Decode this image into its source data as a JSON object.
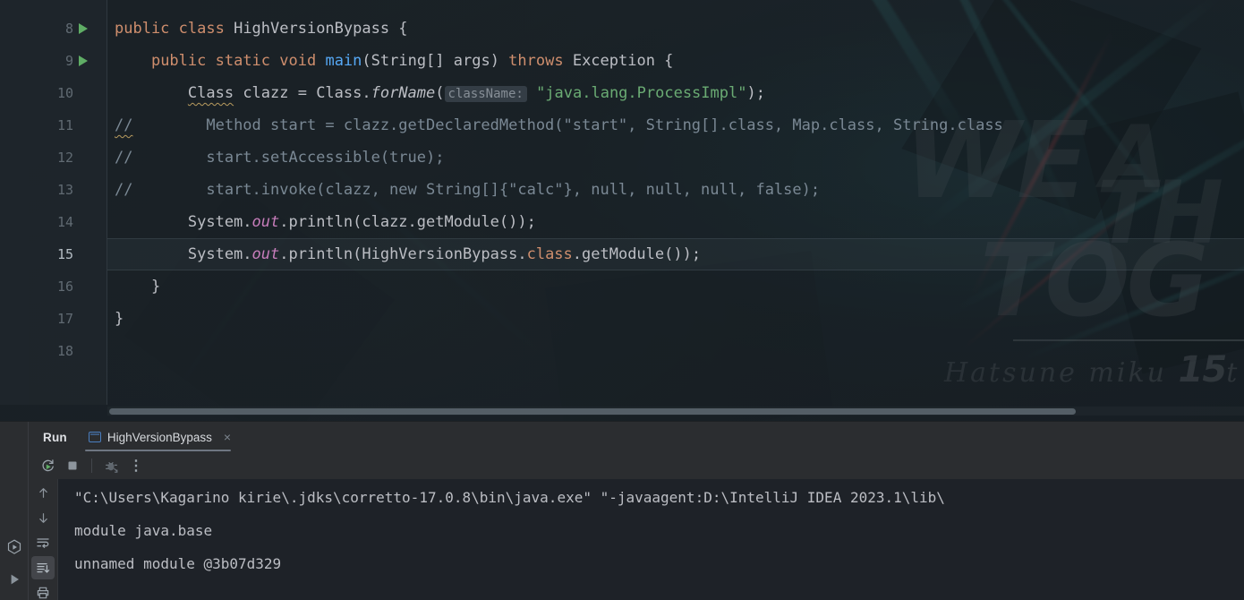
{
  "editor": {
    "first_line_number": 8,
    "current_line_number": 15,
    "lines": [
      {
        "number": "8",
        "has_run_marker": true,
        "tokens": [
          {
            "text": "public ",
            "style": "kw"
          },
          {
            "text": "class ",
            "style": "kw"
          },
          {
            "text": "HighVersionBypass {",
            "style": "plain"
          }
        ]
      },
      {
        "number": "9",
        "has_run_marker": true,
        "tokens": [
          {
            "text": "    ",
            "style": "plain"
          },
          {
            "text": "public ",
            "style": "kw"
          },
          {
            "text": "static ",
            "style": "kw"
          },
          {
            "text": "void ",
            "style": "kw"
          },
          {
            "text": "main",
            "style": "meth"
          },
          {
            "text": "(String[] args) ",
            "style": "plain"
          },
          {
            "text": "throws ",
            "style": "kw"
          },
          {
            "text": "Exception {",
            "style": "plain"
          }
        ]
      },
      {
        "number": "10",
        "has_run_marker": false,
        "tokens": [
          {
            "text": "        ",
            "style": "plain"
          },
          {
            "text": "Class",
            "style": "wavy"
          },
          {
            "text": " clazz = Class.",
            "style": "plain"
          },
          {
            "text": "forName",
            "style": "statmeth"
          },
          {
            "text": "(",
            "style": "plain"
          },
          {
            "text": "className:",
            "style": "hintbox"
          },
          {
            "text": " ",
            "style": "plain"
          },
          {
            "text": "\"java.lang.ProcessImpl\"",
            "style": "str"
          },
          {
            "text": ");",
            "style": "plain"
          }
        ]
      },
      {
        "number": "11",
        "has_run_marker": false,
        "tokens": [
          {
            "text": "//",
            "style": "cmt-wavy"
          },
          {
            "text": "        Method start = clazz.getDeclaredMethod(\"start\", String[].class, Map.class, String.class",
            "style": "cmt"
          }
        ]
      },
      {
        "number": "12",
        "has_run_marker": false,
        "tokens": [
          {
            "text": "//",
            "style": "cmt"
          },
          {
            "text": "        start.setAccessible(true);",
            "style": "cmt"
          }
        ]
      },
      {
        "number": "13",
        "has_run_marker": false,
        "tokens": [
          {
            "text": "//",
            "style": "cmt"
          },
          {
            "text": "        start.invoke(clazz, new String[]{\"calc\"}, null, null, null, false);",
            "style": "cmt"
          }
        ]
      },
      {
        "number": "14",
        "has_run_marker": false,
        "tokens": [
          {
            "text": "        System.",
            "style": "plain"
          },
          {
            "text": "out",
            "style": "field"
          },
          {
            "text": ".println(clazz.getModule());",
            "style": "plain"
          }
        ]
      },
      {
        "number": "15",
        "has_run_marker": false,
        "is_current": true,
        "tokens": [
          {
            "text": "        System.",
            "style": "plain"
          },
          {
            "text": "out",
            "style": "field"
          },
          {
            "text": ".println(HighVersionBypass.",
            "style": "plain"
          },
          {
            "text": "class",
            "style": "kw"
          },
          {
            "text": ".getModule());",
            "style": "plain"
          }
        ]
      },
      {
        "number": "16",
        "has_run_marker": false,
        "tokens": [
          {
            "text": "    }",
            "style": "plain"
          }
        ]
      },
      {
        "number": "17",
        "has_run_marker": false,
        "tokens": [
          {
            "text": "}",
            "style": "plain"
          }
        ]
      },
      {
        "number": "18",
        "has_run_marker": false,
        "tokens": [
          {
            "text": "",
            "style": "plain"
          }
        ]
      }
    ]
  },
  "wallpaper": {
    "word_1": "WE",
    "word_2": "A",
    "word_3": "TH",
    "word_4": "TOG",
    "signature_text": "Hatsune miku ",
    "signature_big": "15",
    "signature_suffix": "t"
  },
  "run_window": {
    "title": "Run",
    "tab": {
      "label": "HighVersionBypass",
      "close_label": "×",
      "icon": "java-app-icon"
    },
    "toolbar": {
      "rerun": "rerun-icon",
      "stop": "stop-icon",
      "debug": "debug-icon",
      "more": "⋮"
    },
    "console_side_toolbar": {
      "up": "arrow-up-icon",
      "down": "arrow-down-icon",
      "soft_wrap": "soft-wrap-icon",
      "scroll_to_end": "scroll-to-end-icon",
      "print": "print-icon"
    },
    "console_output": [
      "\"C:\\Users\\Kagarino kirie\\.jdks\\corretto-17.0.8\\bin\\java.exe\" \"-javaagent:D:\\IntelliJ IDEA 2023.1\\lib\\",
      "module java.base",
      "unnamed module @3b07d329"
    ]
  },
  "left_tool_bar": {
    "run_icon": "run-hexagon-icon",
    "run_icon_2": "run-play-icon"
  },
  "colors": {
    "keyword": "#cf8e6d",
    "method": "#56a8f5",
    "string": "#6aab73",
    "field": "#c77dbb",
    "comment": "#7a8894",
    "default_text": "#bcbec4",
    "run_marker_green": "#5fad65",
    "panel_bg": "#2b2d30",
    "console_bg": "#1e2228"
  }
}
